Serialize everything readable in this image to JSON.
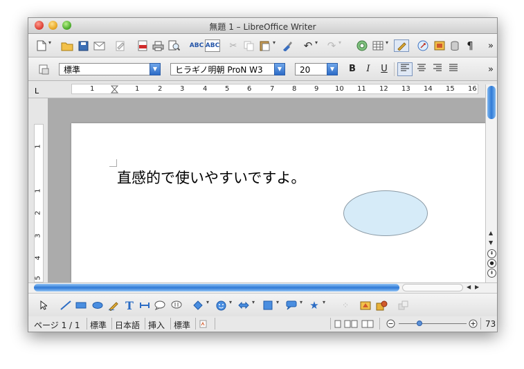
{
  "window": {
    "title": "無題 1 – LibreOffice Writer"
  },
  "toolbar_standard": {
    "more": "»",
    "icons": [
      "new-doc-icon",
      "open-icon",
      "save-icon",
      "email-icon",
      "edit-doc-icon",
      "export-pdf-icon",
      "print-icon",
      "print-preview-icon",
      "spellcheck-icon",
      "autospell-icon",
      "cut-icon",
      "copy-icon",
      "paste-icon",
      "clone-format-icon",
      "undo-icon",
      "redo-icon",
      "navigator-icon",
      "table-icon",
      "show-draw-functions-icon",
      "hyperlink-icon",
      "gallery-icon",
      "data-sources-icon",
      "formatting-marks-icon"
    ]
  },
  "toolbar_formatting": {
    "paragraph_style": "標準",
    "font_name": "ヒラギノ明朝 ProN W3",
    "font_size": "20",
    "bold": "B",
    "italic": "I",
    "underline": "U",
    "more": "»"
  },
  "ruler": {
    "corner": "L",
    "h_numbers": [
      "1",
      "1",
      "2",
      "3",
      "4",
      "5",
      "6",
      "7",
      "8",
      "9",
      "10",
      "11",
      "12",
      "13",
      "14",
      "15",
      "16"
    ],
    "v_numbers": [
      "1",
      "1",
      "2",
      "3",
      "4",
      "5"
    ]
  },
  "document": {
    "text": "直感的で使いやすいですよ。",
    "ellipse_fill": "#d6ebf8"
  },
  "statusbar": {
    "page": "ページ 1 / 1",
    "style": "標準",
    "language": "日本語",
    "insert_mode": "挿入",
    "selection_mode": "標準",
    "zoom": "73"
  }
}
